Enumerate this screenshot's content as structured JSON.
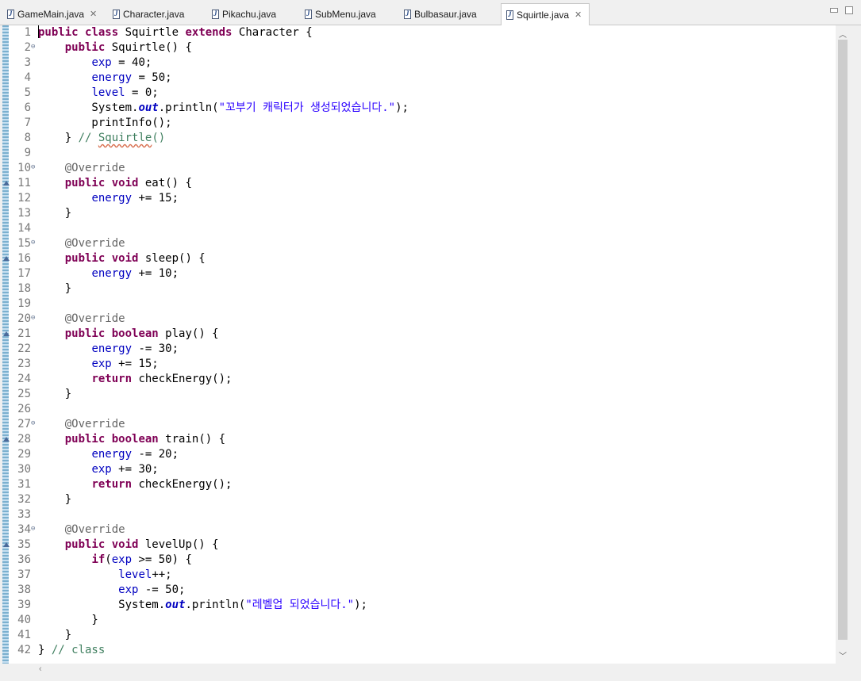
{
  "tabs": [
    {
      "label": "GameMain.java",
      "closable": true,
      "active": false
    },
    {
      "label": "Character.java",
      "closable": false,
      "active": false
    },
    {
      "label": "Pikachu.java",
      "closable": false,
      "active": false
    },
    {
      "label": "SubMenu.java",
      "closable": false,
      "active": false
    },
    {
      "label": "Bulbasaur.java",
      "closable": false,
      "active": false
    },
    {
      "label": "Squirtle.java",
      "closable": true,
      "active": true
    }
  ],
  "tab_close_glyph": "✕",
  "icons": {
    "file": "java-file-icon",
    "close": "close-icon",
    "minimize": "minimize-icon",
    "maximize": "maximize-icon",
    "fold": "fold-collapse-icon",
    "override": "override-marker-icon",
    "scroll_up": "scroll-up-arrow-icon",
    "scroll_down": "scroll-down-arrow-icon",
    "scroll_left": "scroll-left-arrow-icon"
  },
  "colors": {
    "keyword": "#7f0055",
    "field": "#0000c0",
    "string": "#2a00ff",
    "comment": "#3f7f5f",
    "annotation": "#646464",
    "line_number": "#787878"
  },
  "code_lines": [
    {
      "num": "1",
      "fold": false,
      "override": false,
      "tokens": [
        [
          "caret",
          ""
        ],
        [
          "kw",
          "public"
        ],
        [
          "",
          "&nbsp;"
        ],
        [
          "kw",
          "class"
        ],
        [
          "",
          " Squirtle "
        ],
        [
          "kw",
          "extends"
        ],
        [
          "",
          " Character {"
        ]
      ]
    },
    {
      "num": "2",
      "fold": true,
      "override": false,
      "tokens": [
        [
          "",
          "    "
        ],
        [
          "kw",
          "public"
        ],
        [
          "",
          " Squirtle() {"
        ]
      ]
    },
    {
      "num": "3",
      "fold": false,
      "override": false,
      "tokens": [
        [
          "",
          "        "
        ],
        [
          "fld",
          "exp"
        ],
        [
          "",
          " = 40;"
        ]
      ]
    },
    {
      "num": "4",
      "fold": false,
      "override": false,
      "tokens": [
        [
          "",
          "        "
        ],
        [
          "fld",
          "energy"
        ],
        [
          "",
          " = 50;"
        ]
      ]
    },
    {
      "num": "5",
      "fold": false,
      "override": false,
      "tokens": [
        [
          "",
          "        "
        ],
        [
          "fld",
          "level"
        ],
        [
          "",
          " = 0;"
        ]
      ]
    },
    {
      "num": "6",
      "fold": false,
      "override": false,
      "tokens": [
        [
          "",
          "        System."
        ],
        [
          "sfld",
          "out"
        ],
        [
          "",
          ".println("
        ],
        [
          "str",
          "\"꼬부기 캐릭터가 생성되었습니다.\""
        ],
        [
          "",
          ");"
        ]
      ]
    },
    {
      "num": "7",
      "fold": false,
      "override": false,
      "tokens": [
        [
          "",
          "        printInfo();"
        ]
      ]
    },
    {
      "num": "8",
      "fold": false,
      "override": false,
      "tokens": [
        [
          "",
          "    } "
        ],
        [
          "cmt",
          "// "
        ],
        [
          "cmt squig",
          "Squirtle"
        ],
        [
          "cmt",
          "()"
        ]
      ]
    },
    {
      "num": "9",
      "fold": false,
      "override": false,
      "tokens": []
    },
    {
      "num": "10",
      "fold": true,
      "override": false,
      "tokens": [
        [
          "",
          "    "
        ],
        [
          "ann",
          "@Override"
        ]
      ]
    },
    {
      "num": "11",
      "fold": false,
      "override": true,
      "tokens": [
        [
          "",
          "    "
        ],
        [
          "kw",
          "public"
        ],
        [
          "",
          "&nbsp;"
        ],
        [
          "kw",
          "void"
        ],
        [
          "",
          " eat() {"
        ]
      ]
    },
    {
      "num": "12",
      "fold": false,
      "override": false,
      "tokens": [
        [
          "",
          "        "
        ],
        [
          "fld",
          "energy"
        ],
        [
          "",
          " += 15;"
        ]
      ]
    },
    {
      "num": "13",
      "fold": false,
      "override": false,
      "tokens": [
        [
          "",
          "    }"
        ]
      ]
    },
    {
      "num": "14",
      "fold": false,
      "override": false,
      "tokens": []
    },
    {
      "num": "15",
      "fold": true,
      "override": false,
      "tokens": [
        [
          "",
          "    "
        ],
        [
          "ann",
          "@Override"
        ]
      ]
    },
    {
      "num": "16",
      "fold": false,
      "override": true,
      "tokens": [
        [
          "",
          "    "
        ],
        [
          "kw",
          "public"
        ],
        [
          "",
          "&nbsp;"
        ],
        [
          "kw",
          "void"
        ],
        [
          "",
          " sleep() {"
        ]
      ]
    },
    {
      "num": "17",
      "fold": false,
      "override": false,
      "tokens": [
        [
          "",
          "        "
        ],
        [
          "fld",
          "energy"
        ],
        [
          "",
          " += 10;"
        ]
      ]
    },
    {
      "num": "18",
      "fold": false,
      "override": false,
      "tokens": [
        [
          "",
          "    }"
        ]
      ]
    },
    {
      "num": "19",
      "fold": false,
      "override": false,
      "tokens": []
    },
    {
      "num": "20",
      "fold": true,
      "override": false,
      "tokens": [
        [
          "",
          "    "
        ],
        [
          "ann",
          "@Override"
        ]
      ]
    },
    {
      "num": "21",
      "fold": false,
      "override": true,
      "tokens": [
        [
          "",
          "    "
        ],
        [
          "kw",
          "public"
        ],
        [
          "",
          "&nbsp;"
        ],
        [
          "kw",
          "boolean"
        ],
        [
          "",
          " play() {"
        ]
      ]
    },
    {
      "num": "22",
      "fold": false,
      "override": false,
      "tokens": [
        [
          "",
          "        "
        ],
        [
          "fld",
          "energy"
        ],
        [
          "",
          " -= 30;"
        ]
      ]
    },
    {
      "num": "23",
      "fold": false,
      "override": false,
      "tokens": [
        [
          "",
          "        "
        ],
        [
          "fld",
          "exp"
        ],
        [
          "",
          " += 15;"
        ]
      ]
    },
    {
      "num": "24",
      "fold": false,
      "override": false,
      "tokens": [
        [
          "",
          "        "
        ],
        [
          "kw",
          "return"
        ],
        [
          "",
          " checkEnergy();"
        ]
      ]
    },
    {
      "num": "25",
      "fold": false,
      "override": false,
      "tokens": [
        [
          "",
          "    }"
        ]
      ]
    },
    {
      "num": "26",
      "fold": false,
      "override": false,
      "tokens": []
    },
    {
      "num": "27",
      "fold": true,
      "override": false,
      "tokens": [
        [
          "",
          "    "
        ],
        [
          "ann",
          "@Override"
        ]
      ]
    },
    {
      "num": "28",
      "fold": false,
      "override": true,
      "tokens": [
        [
          "",
          "    "
        ],
        [
          "kw",
          "public"
        ],
        [
          "",
          "&nbsp;"
        ],
        [
          "kw",
          "boolean"
        ],
        [
          "",
          " train() {"
        ]
      ]
    },
    {
      "num": "29",
      "fold": false,
      "override": false,
      "tokens": [
        [
          "",
          "        "
        ],
        [
          "fld",
          "energy"
        ],
        [
          "",
          " -= 20;"
        ]
      ]
    },
    {
      "num": "30",
      "fold": false,
      "override": false,
      "tokens": [
        [
          "",
          "        "
        ],
        [
          "fld",
          "exp"
        ],
        [
          "",
          " += 30;"
        ]
      ]
    },
    {
      "num": "31",
      "fold": false,
      "override": false,
      "tokens": [
        [
          "",
          "        "
        ],
        [
          "kw",
          "return"
        ],
        [
          "",
          " checkEnergy();"
        ]
      ]
    },
    {
      "num": "32",
      "fold": false,
      "override": false,
      "tokens": [
        [
          "",
          "    }"
        ]
      ]
    },
    {
      "num": "33",
      "fold": false,
      "override": false,
      "tokens": []
    },
    {
      "num": "34",
      "fold": true,
      "override": false,
      "tokens": [
        [
          "",
          "    "
        ],
        [
          "ann",
          "@Override"
        ]
      ]
    },
    {
      "num": "35",
      "fold": false,
      "override": true,
      "tokens": [
        [
          "",
          "    "
        ],
        [
          "kw",
          "public"
        ],
        [
          "",
          "&nbsp;"
        ],
        [
          "kw",
          "void"
        ],
        [
          "",
          " levelUp() {"
        ]
      ]
    },
    {
      "num": "36",
      "fold": false,
      "override": false,
      "tokens": [
        [
          "",
          "        "
        ],
        [
          "kw",
          "if"
        ],
        [
          "",
          "("
        ],
        [
          "fld",
          "exp"
        ],
        [
          "",
          " >= 50) {"
        ]
      ]
    },
    {
      "num": "37",
      "fold": false,
      "override": false,
      "tokens": [
        [
          "",
          "            "
        ],
        [
          "fld",
          "level"
        ],
        [
          "",
          "++;"
        ]
      ]
    },
    {
      "num": "38",
      "fold": false,
      "override": false,
      "tokens": [
        [
          "",
          "            "
        ],
        [
          "fld",
          "exp"
        ],
        [
          "",
          " -= 50;"
        ]
      ]
    },
    {
      "num": "39",
      "fold": false,
      "override": false,
      "tokens": [
        [
          "",
          "            System."
        ],
        [
          "sfld",
          "out"
        ],
        [
          "",
          ".println("
        ],
        [
          "str",
          "\"레벨업 되었습니다.\""
        ],
        [
          "",
          ");"
        ]
      ]
    },
    {
      "num": "40",
      "fold": false,
      "override": false,
      "tokens": [
        [
          "",
          "        }"
        ]
      ]
    },
    {
      "num": "41",
      "fold": false,
      "override": false,
      "tokens": [
        [
          "",
          "    }"
        ]
      ]
    },
    {
      "num": "42",
      "fold": false,
      "override": false,
      "tokens": [
        [
          "",
          "} "
        ],
        [
          "cmt",
          "// class"
        ]
      ]
    }
  ]
}
